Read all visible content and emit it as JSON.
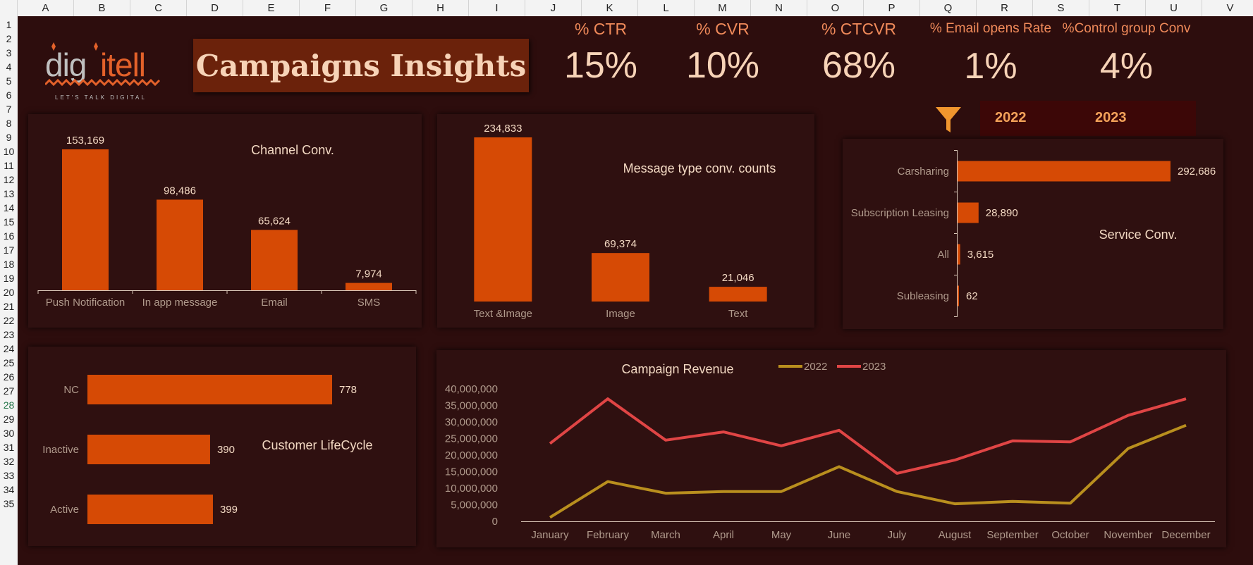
{
  "spreadsheet": {
    "columns": [
      "A",
      "B",
      "C",
      "D",
      "E",
      "F",
      "G",
      "H",
      "I",
      "J",
      "K",
      "L",
      "M",
      "N",
      "O",
      "P",
      "Q",
      "R",
      "S",
      "T",
      "U",
      "V"
    ],
    "rows": [
      "1",
      "2",
      "3",
      "4",
      "5",
      "6",
      "7",
      "8",
      "9",
      "10",
      "11",
      "12",
      "13",
      "14",
      "15",
      "16",
      "17",
      "18",
      "19",
      "20",
      "21",
      "22",
      "23",
      "24",
      "25",
      "26",
      "27",
      "28",
      "29",
      "30",
      "31",
      "32",
      "33",
      "34",
      "35"
    ],
    "selected_row": "28"
  },
  "logo": {
    "brand": "digitell",
    "tagline": "LET'S TALK DIGITAL"
  },
  "dashboard": {
    "title": "Campaigns Insights"
  },
  "kpis": [
    {
      "label": "% CTR",
      "value": "15%"
    },
    {
      "label": "% CVR",
      "value": "10%"
    },
    {
      "label": "% CTCVR",
      "value": "68%"
    },
    {
      "label": "% Email opens Rate",
      "value": "1%"
    },
    {
      "label": "%Control group Conv",
      "value": "4%"
    }
  ],
  "filter": {
    "icon": "funnel-icon",
    "years": [
      "2022",
      "2023"
    ]
  },
  "colors": {
    "background": "#2d0d0d",
    "bar": "#d64a05",
    "line_2022": "#b98f1e",
    "line_2023": "#e04545",
    "text": "#f3d9c3",
    "muted": "#b09a8c"
  },
  "chart_data": [
    {
      "id": "channel",
      "type": "bar",
      "title": "Channel Conv.",
      "categories": [
        "Push Notification",
        "In app message",
        "Email",
        "SMS"
      ],
      "values": [
        153169,
        98486,
        65624,
        7974
      ],
      "labels": [
        "153,169",
        "98,486",
        "65,624",
        "7,974"
      ]
    },
    {
      "id": "message",
      "type": "bar",
      "title": "Message type conv. counts",
      "categories": [
        "Text &Image",
        "Image",
        "Text"
      ],
      "values": [
        234833,
        69374,
        21046
      ],
      "labels": [
        "234,833",
        "69,374",
        "21,046"
      ]
    },
    {
      "id": "service",
      "type": "bar",
      "orientation": "horizontal",
      "title": "Service Conv.",
      "categories": [
        "Carsharing",
        "Subscription Leasing",
        "All",
        "Subleasing"
      ],
      "values": [
        292686,
        28890,
        3615,
        62
      ],
      "labels": [
        "292,686",
        "28,890",
        "3,615",
        "62"
      ]
    },
    {
      "id": "lifecycle",
      "type": "bar",
      "orientation": "horizontal",
      "title": "Customer LifeCycle",
      "categories": [
        "NC",
        "Inactive",
        "Active"
      ],
      "values": [
        778,
        390,
        399
      ],
      "labels": [
        "778",
        "390",
        "399"
      ]
    },
    {
      "id": "revenue",
      "type": "line",
      "title": "Campaign Revenue",
      "x": [
        "January",
        "February",
        "March",
        "April",
        "May",
        "June",
        "July",
        "August",
        "September",
        "October",
        "November",
        "December"
      ],
      "ylim": [
        0,
        40000000
      ],
      "yticks": [
        "0",
        "5,000,000",
        "10,000,000",
        "15,000,000",
        "20,000,000",
        "25,000,000",
        "30,000,000",
        "35,000,000",
        "40,000,000"
      ],
      "legend": "top",
      "series": [
        {
          "name": "2022",
          "values": [
            1200000,
            12000000,
            8500000,
            9000000,
            9000000,
            16500000,
            9000000,
            5300000,
            6000000,
            5500000,
            22000000,
            29000000
          ]
        },
        {
          "name": "2023",
          "values": [
            23500000,
            37000000,
            24500000,
            27000000,
            22800000,
            27500000,
            14500000,
            18500000,
            24300000,
            24000000,
            32000000,
            37000000
          ]
        }
      ]
    }
  ]
}
